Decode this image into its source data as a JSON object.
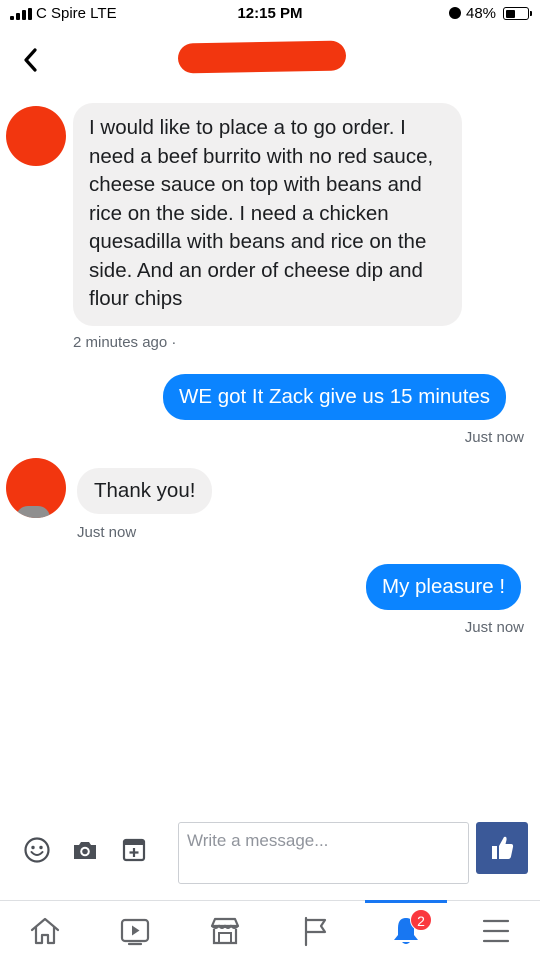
{
  "status_bar": {
    "carrier": "C Spire  LTE",
    "time": "12:15 PM",
    "battery": "48%",
    "battery_level": 0.48
  },
  "header": {
    "back_icon": "chevron-left-icon"
  },
  "messages": [
    {
      "direction": "incoming",
      "text": "I would like to place a to go order. I need a beef burrito with no red sauce, cheese sauce on top with beans and rice on the side. I need a chicken quesadilla with beans and rice on the side. And an order of cheese dip and flour chips",
      "meta": "2 minutes ago ·"
    },
    {
      "direction": "outgoing",
      "text": "WE got It Zack give us 15 minutes",
      "meta": "Just now"
    },
    {
      "direction": "incoming",
      "text": "Thank you!",
      "meta": "Just now"
    },
    {
      "direction": "outgoing",
      "text": "My pleasure !",
      "meta": "Just now"
    }
  ],
  "composer": {
    "placeholder": "Write a message...",
    "emoji_icon": "smiley-icon",
    "camera_icon": "camera-icon",
    "sticker_icon": "sticker-icon",
    "like_icon": "thumbs-up-icon"
  },
  "bottom_nav": {
    "items": [
      "home-icon",
      "watch-icon",
      "marketplace-icon",
      "pages-flag-icon",
      "notifications-bell-icon",
      "menu-icon"
    ],
    "notification_badge": "2",
    "active": "notifications"
  },
  "colors": {
    "outgoing_bubble": "#0b84ff",
    "incoming_bubble": "#f1f0f0",
    "like_button": "#3b5998",
    "redaction": "#f2360f",
    "badge": "#fa383e",
    "active_tab": "#1877f2"
  }
}
